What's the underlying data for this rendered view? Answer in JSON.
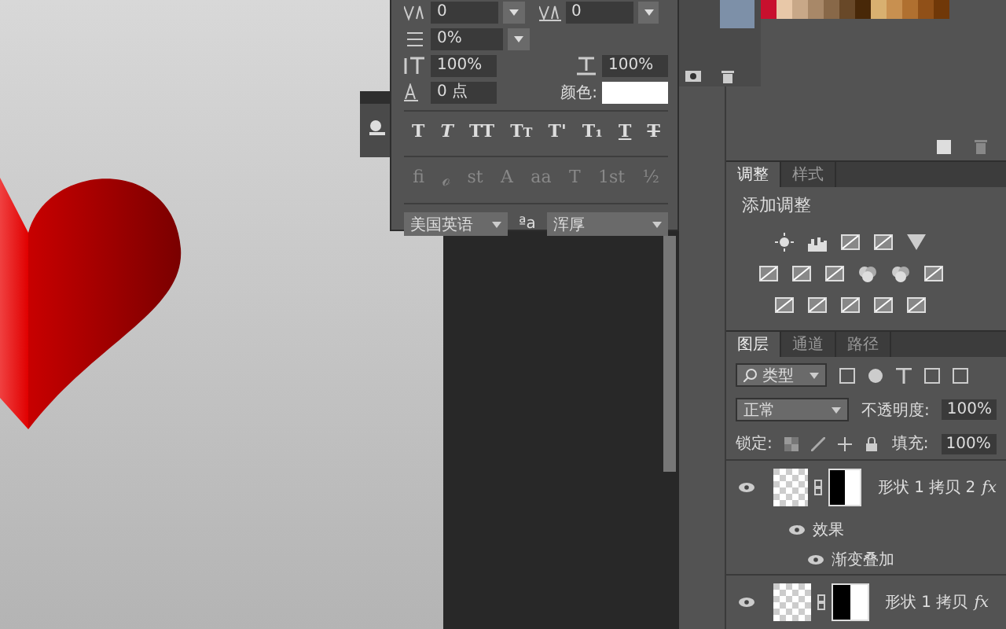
{
  "character_panel": {
    "kerning": "0",
    "tracking": "0",
    "tsume": "0%",
    "vertical_scale": "100%",
    "horizontal_scale": "100%",
    "baseline_shift": "0 点",
    "color_label": "颜色:",
    "color": "#ffffff",
    "style_buttons": [
      {
        "label": "T"
      },
      {
        "label": "T"
      },
      {
        "label": "TT"
      },
      {
        "label": "Tт"
      },
      {
        "label": "T'"
      },
      {
        "label": "T₁"
      },
      {
        "label": "T"
      },
      {
        "label": "T"
      }
    ],
    "opentype_buttons": [
      {
        "label": "fi",
        "disabled": true
      },
      {
        "label": "ℴ",
        "disabled": true
      },
      {
        "label": "st",
        "disabled": true
      },
      {
        "label": "A",
        "disabled": true
      },
      {
        "label": "aa",
        "disabled": true
      },
      {
        "label": "T",
        "disabled": true
      },
      {
        "label": "1st",
        "disabled": true
      },
      {
        "label": "½",
        "disabled": true
      }
    ],
    "language": "美国英语",
    "antialias_icon": "ªa",
    "antialias": "浑厚"
  },
  "swatches": [
    {
      "color": "#c8102e"
    },
    {
      "color": "#e8c8a8"
    },
    {
      "color": "#c8a888"
    },
    {
      "color": "#a88868"
    },
    {
      "color": "#886848"
    },
    {
      "color": "#684828"
    },
    {
      "color": "#482808"
    },
    {
      "color": "#d8b070"
    },
    {
      "color": "#c89050"
    },
    {
      "color": "#b07030"
    },
    {
      "color": "#905018"
    },
    {
      "color": "#703808"
    }
  ],
  "adjustments_panel": {
    "tabs": [
      {
        "label": "调整",
        "selected": true
      },
      {
        "label": "样式",
        "selected": false
      }
    ],
    "heading": "添加调整"
  },
  "layers_panel": {
    "tabs": [
      {
        "label": "图层",
        "selected": true
      },
      {
        "label": "通道",
        "selected": false
      },
      {
        "label": "路径",
        "selected": false
      }
    ],
    "filter": "类型",
    "blend_mode": "正常",
    "opacity_label": "不透明度:",
    "opacity": "100%",
    "lock_label": "锁定:",
    "fill_label": "填充:",
    "fill": "100%",
    "layers": [
      {
        "name": "形状 1 拷贝 2",
        "badge": "fx",
        "visible": true,
        "effects_label": "效果",
        "effects": [
          {
            "name": "渐变叠加",
            "visible": true
          }
        ]
      },
      {
        "name": "形状 1 拷贝",
        "badge": "fx",
        "visible": true
      }
    ]
  }
}
